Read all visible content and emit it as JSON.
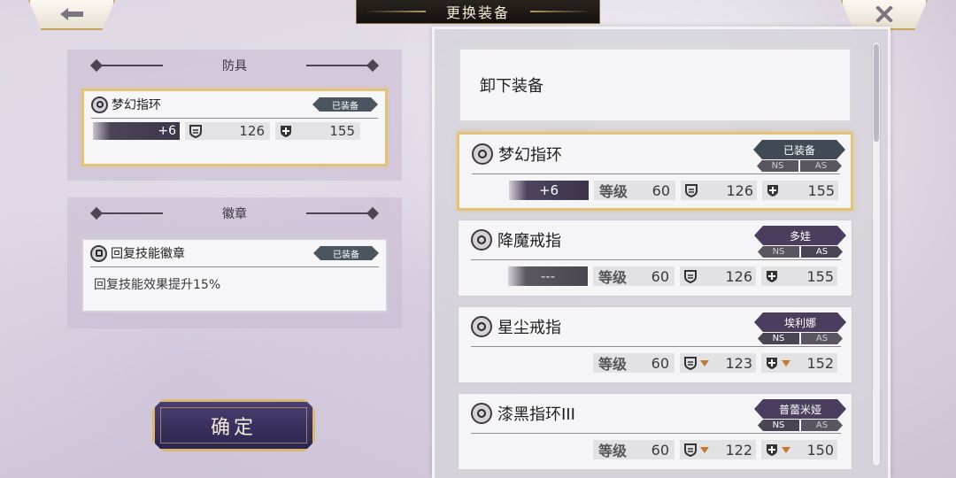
{
  "header": {
    "title": "更换装备",
    "back_icon": "arrow-left-icon",
    "close_icon": "close-icon"
  },
  "left": {
    "armor": {
      "heading": "防具",
      "item": {
        "name": "梦幻指环",
        "tag": "已装备",
        "plus": "+6",
        "def": "126",
        "mdef": "155"
      }
    },
    "badge": {
      "heading": "徽章",
      "item": {
        "name": "回复技能徽章",
        "tag": "已装备",
        "desc": "回复技能效果提升15%"
      }
    },
    "confirm_label": "确定"
  },
  "list": {
    "unequip_label": "卸下装备",
    "level_label": "等级",
    "items": [
      {
        "name": "梦幻指环",
        "owner": "已装备",
        "owner_color": "#3f4a55",
        "ns": "NS",
        "as": "AS",
        "ns_active": false,
        "as_active": false,
        "plus": "+6",
        "level": "60",
        "def": "126",
        "mdef": "155",
        "def_down": false,
        "mdef_down": false
      },
      {
        "name": "降魔戒指",
        "owner": "多娃",
        "owner_color": "#4a3d5e",
        "ns": "NS",
        "as": "AS",
        "ns_active": false,
        "as_active": true,
        "plus": "---",
        "level": "60",
        "def": "126",
        "mdef": "155",
        "def_down": false,
        "mdef_down": false
      },
      {
        "name": "星尘戒指",
        "owner": "埃利娜",
        "owner_color": "#4a3d5e",
        "ns": "NS",
        "as": "AS",
        "ns_active": true,
        "as_active": false,
        "plus": "",
        "level": "60",
        "def": "123",
        "mdef": "152",
        "def_down": true,
        "mdef_down": true
      },
      {
        "name": "漆黑指环III",
        "owner": "普蕾米娅",
        "owner_color": "#4a3d5e",
        "ns": "NS",
        "as": "AS",
        "ns_active": true,
        "as_active": false,
        "plus": "",
        "level": "60",
        "def": "122",
        "mdef": "150",
        "def_down": true,
        "mdef_down": true
      }
    ]
  },
  "colors": {
    "gold_border": "#e3c27a",
    "equipped_tag": "#4a5560",
    "owner_tag": "#4a3d5e",
    "stat_down": "#c8782e"
  }
}
